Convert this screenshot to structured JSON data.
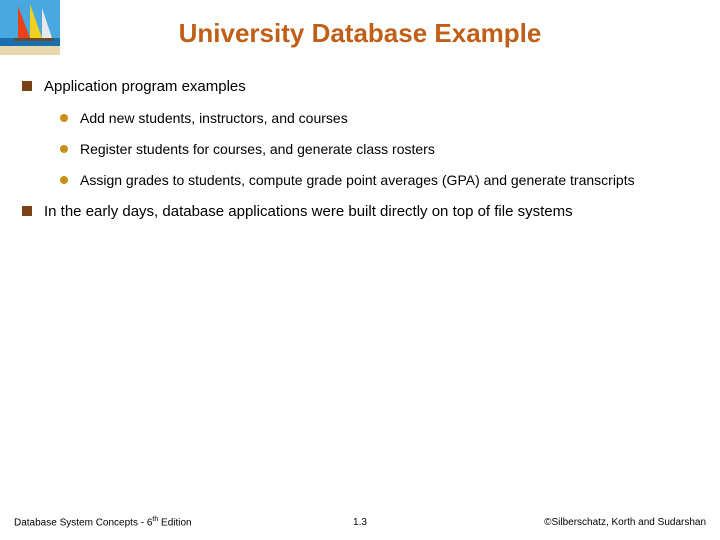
{
  "title": "University Database Example",
  "bullets": [
    {
      "text": "Application program examples",
      "children": [
        "Add new students, instructors, and courses",
        "Register students for courses, and generate class rosters",
        "Assign grades to students, compute grade point averages (GPA) and generate transcripts"
      ]
    },
    {
      "text": "In the early days, database applications were built directly on top of file systems",
      "children": []
    }
  ],
  "footer": {
    "left_prefix": "Database System Concepts - 6",
    "left_sup": "th",
    "left_suffix": " Edition",
    "center": "1.3",
    "right": "©Silberschatz, Korth and Sudarshan"
  },
  "logo": {
    "sky": "#4aa8e0",
    "sail1": "#e8421a",
    "sail2": "#f0d020",
    "sail3": "#e8e8e8",
    "sea": "#1870b0",
    "sand": "#e8d8b0"
  }
}
